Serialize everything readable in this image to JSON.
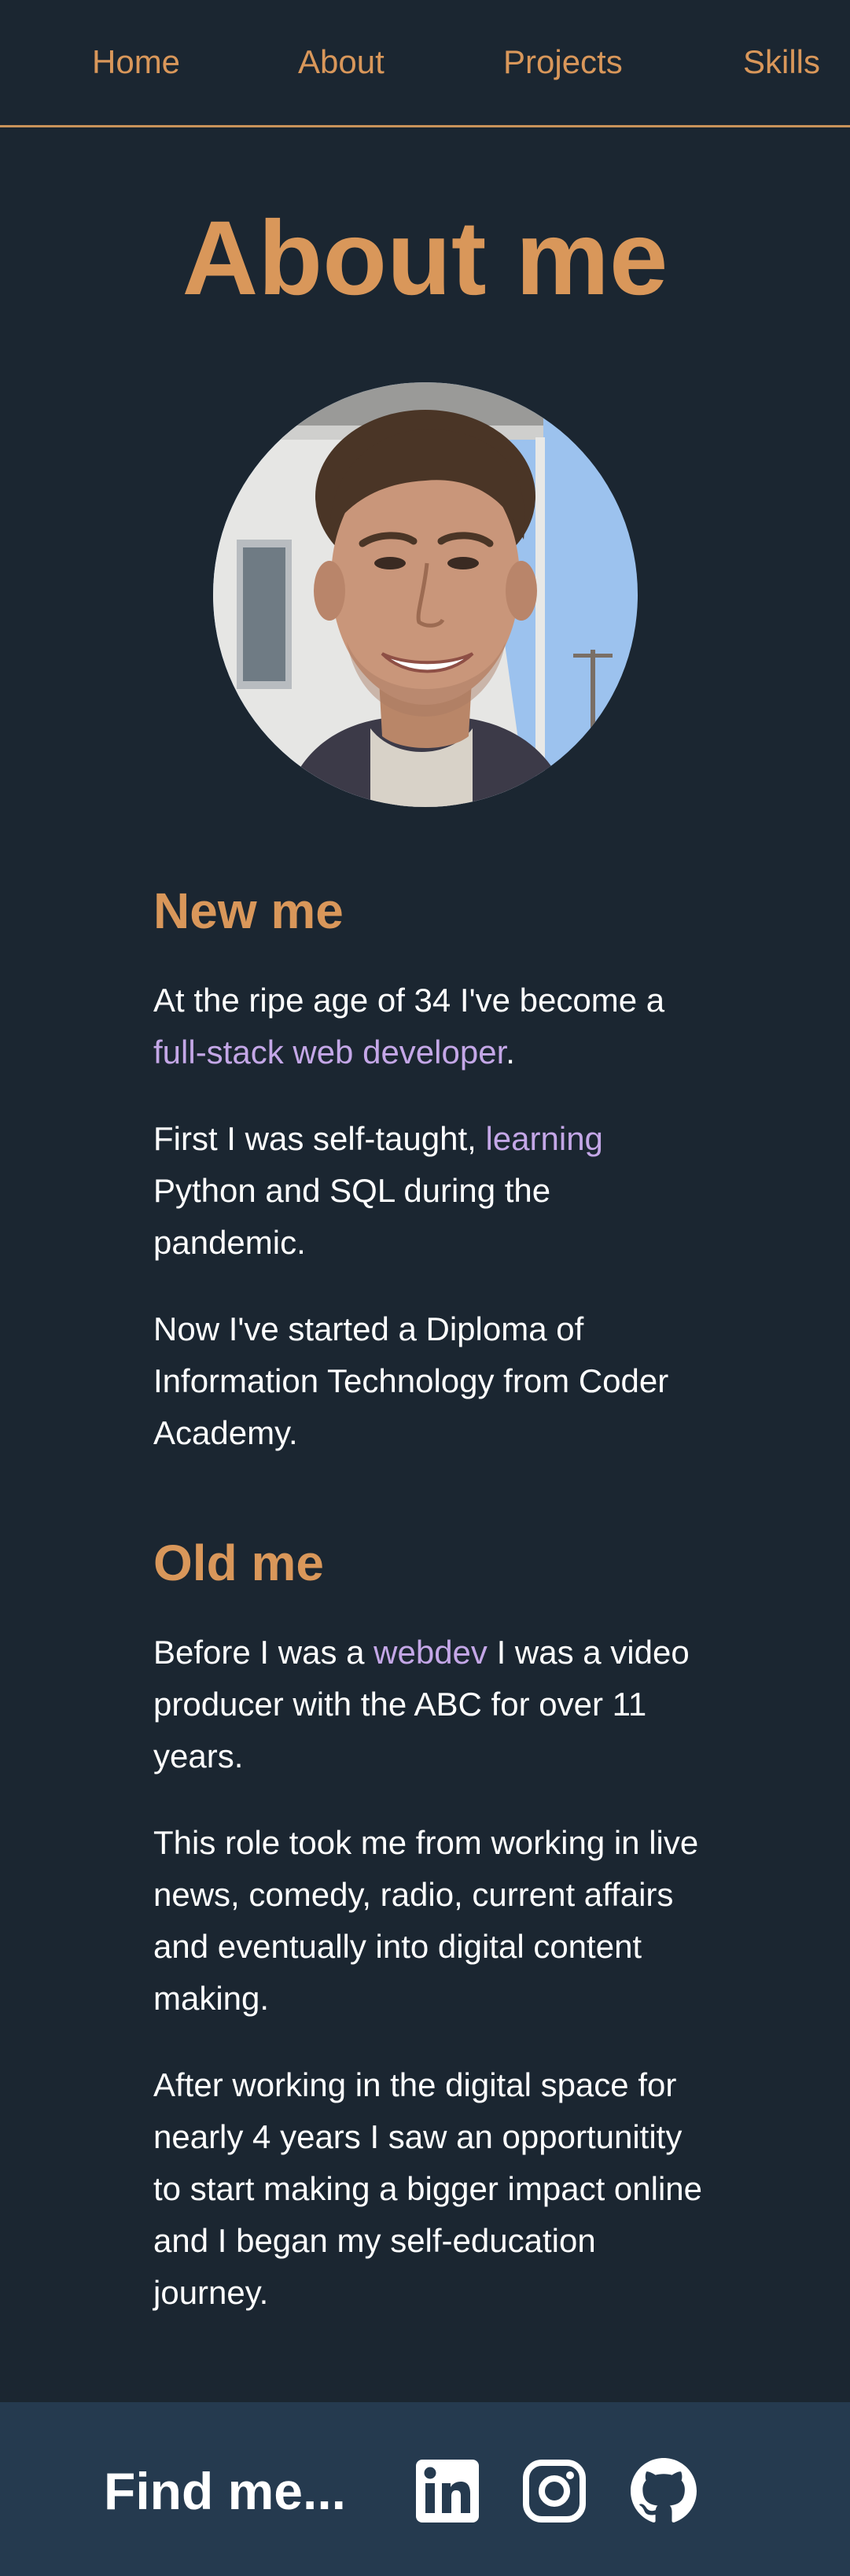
{
  "nav": {
    "items": [
      {
        "label": "Home"
      },
      {
        "label": "About"
      },
      {
        "label": "Projects"
      },
      {
        "label": "Skills"
      }
    ]
  },
  "page": {
    "title": "About me"
  },
  "avatar": {
    "alt": "portrait photo"
  },
  "sections": {
    "new_me": {
      "heading": "New me",
      "p1_before": "At the ripe age of 34 I've become a ",
      "p1_link": "full-stack web developer",
      "p1_after": ".",
      "p2_before": "First I was self-taught, ",
      "p2_link": "learning",
      "p2_after": " Python and SQL during the pandemic.",
      "p3": "Now I've started a Diploma of Information Technology from Coder Academy."
    },
    "old_me": {
      "heading": "Old me",
      "p1_before": "Before I was a ",
      "p1_link": "webdev",
      "p1_after": " I was a video producer with the ABC for over 11 years.",
      "p2": "This role took me from working in live news, comedy, radio, current affairs and eventually into digital content making.",
      "p3": "After working in the digital space for nearly 4 years I saw an opportunitity to start making a bigger impact online and I began my self-education journey."
    }
  },
  "footer": {
    "label": "Find me...",
    "icons": [
      "linkedin-icon",
      "instagram-icon",
      "github-icon"
    ]
  },
  "colors": {
    "background": "#1b2631",
    "accent": "#d9975a",
    "highlight": "#c4a7e7",
    "footer_bg": "#253a4f",
    "text": "#ffffff"
  }
}
